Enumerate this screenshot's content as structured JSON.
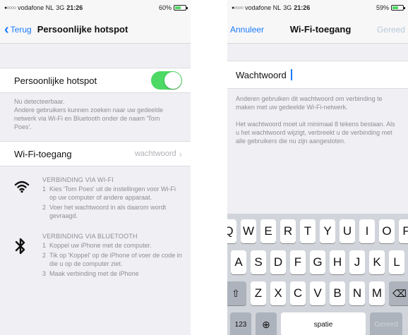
{
  "left": {
    "status": {
      "carrier": "vodafone NL",
      "network": "3G",
      "time": "21:26",
      "battery": "60%",
      "battery_level": 0.6
    },
    "nav": {
      "back_label": "Terug",
      "title": "Persoonlijke hotspot"
    },
    "hotspot": {
      "label": "Persoonlijke hotspot",
      "enabled": true
    },
    "footnote": {
      "line1": "Nu detecteerbaar.",
      "line2": "Andere gebruikers kunnen zoeken naar uw gedeelde netwerk via Wi-Fi en Bluetooth onder de naam 'Tom Poes'."
    },
    "wifi_access": {
      "label": "Wi-Fi-toegang",
      "value": "wachtwoord"
    },
    "wifi_section": {
      "heading": "VERBINDING VIA WI-FI",
      "steps": [
        {
          "num": "1",
          "text": "Kies 'Tom Poes' uit de instellingen voor Wi-Fi op uw computer of andere apparaat."
        },
        {
          "num": "2",
          "text": "Voer het wachtwoord in als daarom wordt gevraagd."
        }
      ]
    },
    "bt_section": {
      "heading": "VERBINDING VIA BLUETOOTH",
      "steps": [
        {
          "num": "1",
          "text": "Koppel uw iPhone met de computer."
        },
        {
          "num": "2",
          "text": "Tik op 'Koppel' op de iPhone of voer de code in die u op de computer ziet."
        },
        {
          "num": "3",
          "text": "Maak verbinding met de iPhone"
        }
      ]
    }
  },
  "right": {
    "status": {
      "carrier": "vodafone NL",
      "network": "3G",
      "time": "21:26",
      "battery": "59%",
      "battery_level": 0.59
    },
    "nav": {
      "cancel_label": "Annuleer",
      "title": "Wi-Fi-toegang",
      "done_label": "Gereed"
    },
    "password": {
      "label": "Wachtwoord"
    },
    "footnote": {
      "p1": "Anderen gebruiken dit wachtwoord om verbinding te maken met uw gedeelde Wi-Fi-netwerk.",
      "p2": "Het wachtwoord moet uit minimaal 8 tekens bestaan. Als u het wachtwoord wijzigt, verbreekt u de verbinding met alle gebruikers die nu zijn aangesloten."
    },
    "keyboard": {
      "row1": [
        "Q",
        "W",
        "E",
        "R",
        "T",
        "Y",
        "U",
        "I",
        "O",
        "P"
      ],
      "row2": [
        "A",
        "S",
        "D",
        "F",
        "G",
        "H",
        "J",
        "K",
        "L"
      ],
      "row3": [
        "Z",
        "X",
        "C",
        "V",
        "B",
        "N",
        "M"
      ],
      "numbers_label": "123",
      "space_label": "spatie",
      "done_label": "Gereed"
    }
  },
  "colors": {
    "accent": "#1a7af8",
    "toggle_on": "#4cd964",
    "background": "#efeff4"
  },
  "icons": [
    "chevron-left-icon",
    "wifi-icon",
    "bluetooth-icon",
    "globe-icon",
    "shift-icon",
    "backspace-icon"
  ]
}
